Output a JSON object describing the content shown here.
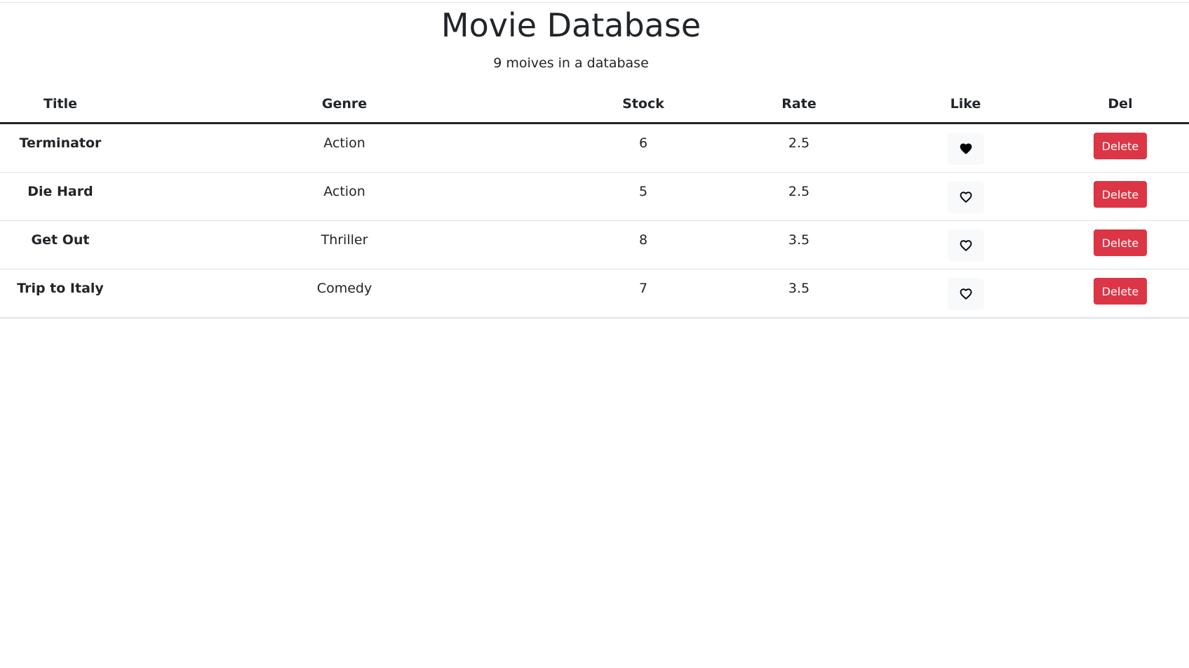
{
  "header": {
    "title": "Movie Database",
    "subtitle": "9 moives in a database"
  },
  "table": {
    "columns": [
      "Title",
      "Genre",
      "Stock",
      "Rate",
      "Like",
      "Del"
    ],
    "rows": [
      {
        "title": "Terminator",
        "genre": "Action",
        "stock": "6",
        "rate": "2.5",
        "liked": true,
        "delete_label": "Delete"
      },
      {
        "title": "Die Hard",
        "genre": "Action",
        "stock": "5",
        "rate": "2.5",
        "liked": false,
        "delete_label": "Delete"
      },
      {
        "title": "Get Out",
        "genre": "Thriller",
        "stock": "8",
        "rate": "3.5",
        "liked": false,
        "delete_label": "Delete"
      },
      {
        "title": "Trip to Italy",
        "genre": "Comedy",
        "stock": "7",
        "rate": "3.5",
        "liked": false,
        "delete_label": "Delete"
      }
    ]
  },
  "colors": {
    "delete_button": "#dc3545",
    "like_button_bg": "#f8f9fa",
    "text": "#212529"
  },
  "icons": {
    "liked": "heart-filled-icon",
    "not_liked": "heart-outline-icon"
  }
}
